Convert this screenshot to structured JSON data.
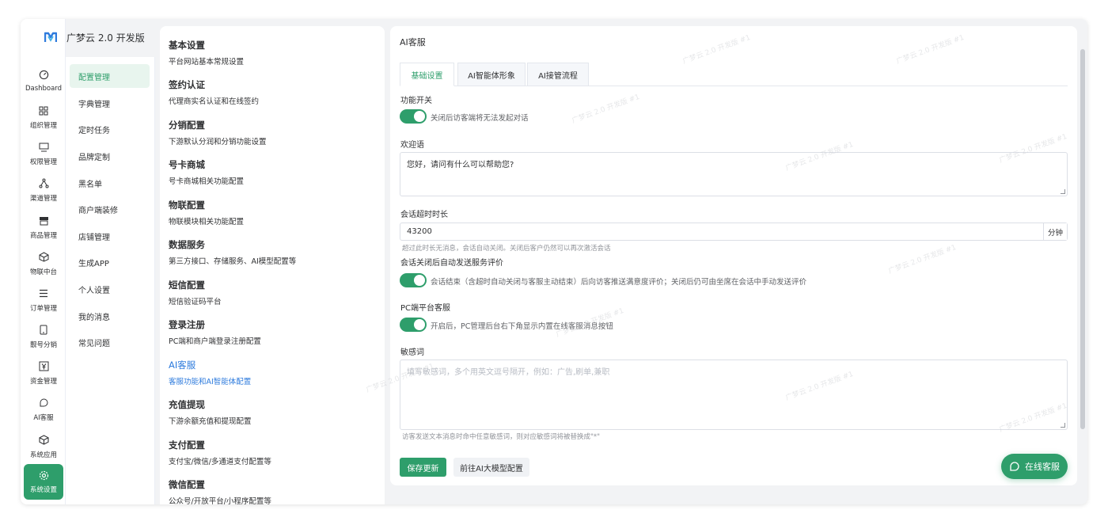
{
  "app": {
    "title": "广梦云 2.0 开发版",
    "accent": "#2e9e6b",
    "link_color": "#2e7bdd"
  },
  "rail": {
    "items": [
      {
        "label": "Dashboard",
        "icon": "dashboard-icon"
      },
      {
        "label": "组织管理",
        "icon": "grid-icon"
      },
      {
        "label": "权限管理",
        "icon": "monitor-icon"
      },
      {
        "label": "渠道管理",
        "icon": "network-icon"
      },
      {
        "label": "商品管理",
        "icon": "store-icon"
      },
      {
        "label": "物联中台",
        "icon": "cube-icon"
      },
      {
        "label": "订单管理",
        "icon": "list-icon"
      },
      {
        "label": "靓号分销",
        "icon": "phone-icon"
      },
      {
        "label": "资金管理",
        "icon": "yuan-icon"
      },
      {
        "label": "AI客服",
        "icon": "chat-icon"
      },
      {
        "label": "系统应用",
        "icon": "box-icon"
      },
      {
        "label": "系统设置",
        "icon": "gear-icon"
      }
    ]
  },
  "submenu": {
    "items": [
      "配置管理",
      "字典管理",
      "定时任务",
      "品牌定制",
      "黑名单",
      "商户端装修",
      "店铺管理",
      "生成APP",
      "个人设置",
      "我的消息",
      "常见问题"
    ]
  },
  "settings": {
    "items": [
      {
        "title": "基本设置",
        "desc": "平台网站基本常规设置"
      },
      {
        "title": "签约认证",
        "desc": "代理商实名认证和在线签约"
      },
      {
        "title": "分销配置",
        "desc": "下游默认分润和分销功能设置"
      },
      {
        "title": "号卡商城",
        "desc": "号卡商城相关功能配置"
      },
      {
        "title": "物联配置",
        "desc": "物联模块相关功能配置"
      },
      {
        "title": "数据服务",
        "desc": "第三方接口、存储服务、AI模型配置等"
      },
      {
        "title": "短信配置",
        "desc": "短信验证码平台"
      },
      {
        "title": "登录注册",
        "desc": "PC端和商户端登录注册配置"
      },
      {
        "title": "AI客服",
        "desc": "客服功能和AI智能体配置"
      },
      {
        "title": "充值提现",
        "desc": "下游余额充值和提现配置"
      },
      {
        "title": "支付配置",
        "desc": "支付宝/微信/多通道支付配置等"
      },
      {
        "title": "微信配置",
        "desc": "公众号/开放平台/小程序配置等"
      }
    ]
  },
  "main": {
    "title": "AI客服",
    "tabs": [
      "基础设置",
      "AI智能体形象",
      "AI接管流程"
    ],
    "feature_switch": {
      "label": "功能开关",
      "desc": "关闭后访客端将无法发起对话"
    },
    "greeting": {
      "label": "欢迎语",
      "value": "您好，请问有什么可以帮助您?"
    },
    "timeout": {
      "label": "会话超时时长",
      "value": "43200",
      "unit": "分钟",
      "hint": "超过此时长无消息，会话自动关闭。关闭后客户仍然可以再次激活会话"
    },
    "rating": {
      "label": "会话关闭后自动发送服务评价",
      "desc": "会话结束（含超时自动关闭与客服主动结束）后向访客推送满意度评价；关闭后仍可由坐席在会话中手动发送评价"
    },
    "pc_service": {
      "label": "PC端平台客服",
      "desc": "开启后，PC管理后台右下角显示内置在线客服消息按钮"
    },
    "sensitive": {
      "label": "敏感词",
      "placeholder": "填写敏感词，多个用英文逗号隔开，例如：广告,刷单,兼职",
      "hint": "访客发送文本消息时命中任意敏感词，则对应敏感词将被替换成\"*\""
    },
    "save_label": "保存更新",
    "goto_label": "前往AI大模型配置"
  },
  "float": {
    "label": "在线客服"
  },
  "watermark": "广梦云 2.0 开发版 #1"
}
